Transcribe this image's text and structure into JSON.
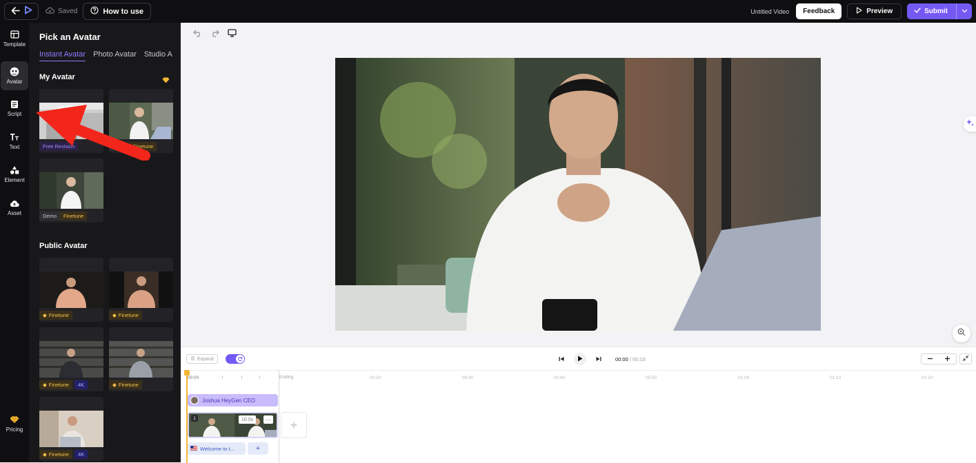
{
  "topbar": {
    "saved_label": "Saved",
    "how_to_label": "How to use",
    "video_title": "Untitled Video",
    "feedback_label": "Feedback",
    "preview_label": "Preview",
    "submit_label": "Submit"
  },
  "rail": {
    "items": [
      {
        "label": "Template",
        "icon": "template-icon"
      },
      {
        "label": "Avatar",
        "icon": "avatar-icon",
        "active": true
      },
      {
        "label": "Script",
        "icon": "script-icon"
      },
      {
        "label": "Text",
        "icon": "text-icon"
      },
      {
        "label": "Element",
        "icon": "element-icon"
      },
      {
        "label": "Asset",
        "icon": "asset-icon"
      }
    ],
    "pricing_label": "Pricing"
  },
  "panel": {
    "title": "Pick an Avatar",
    "tabs": [
      "Instant Avatar",
      "Photo Avatar",
      "Studio A"
    ],
    "my_avatar_title": "My Avatar",
    "public_avatar_title": "Public Avatar",
    "my_cards": [
      {
        "tag1": "Free Revision",
        "tag2": ""
      },
      {
        "tag1": "Demo",
        "tag2": "Finetune"
      },
      {
        "tag1": "Demo",
        "tag2": "Finetune"
      }
    ],
    "public_cards": [
      {
        "tag": "Finetune",
        "extra": ""
      },
      {
        "tag": "Finetune",
        "extra": ""
      },
      {
        "tag": "Finetune",
        "extra": "4K"
      },
      {
        "tag": "Finetune",
        "extra": ""
      },
      {
        "tag": "Finetune",
        "extra": "4K"
      }
    ]
  },
  "timeline": {
    "expand_label": "Expand",
    "time_current": "00:00",
    "time_total": "/ 00:10",
    "ruler": [
      "00:00",
      "Ending",
      "00:20",
      "00:30",
      "00:40",
      "00:50",
      "01:00",
      "01:10",
      "01:20"
    ],
    "avatar_track_label": "Joshua HeyGen CEO",
    "scene_number": "1",
    "scene_duration": "10.0s",
    "scene_more": "···",
    "script_track_label": "Welcome to t...",
    "script_add": "+",
    "add_scene": "+"
  },
  "colors": {
    "accent": "#7559f5",
    "dark_bg": "#0f0f11",
    "panel_bg": "#18181b",
    "finetune_gold": "#f3c24b",
    "playhead": "#f3b634"
  }
}
